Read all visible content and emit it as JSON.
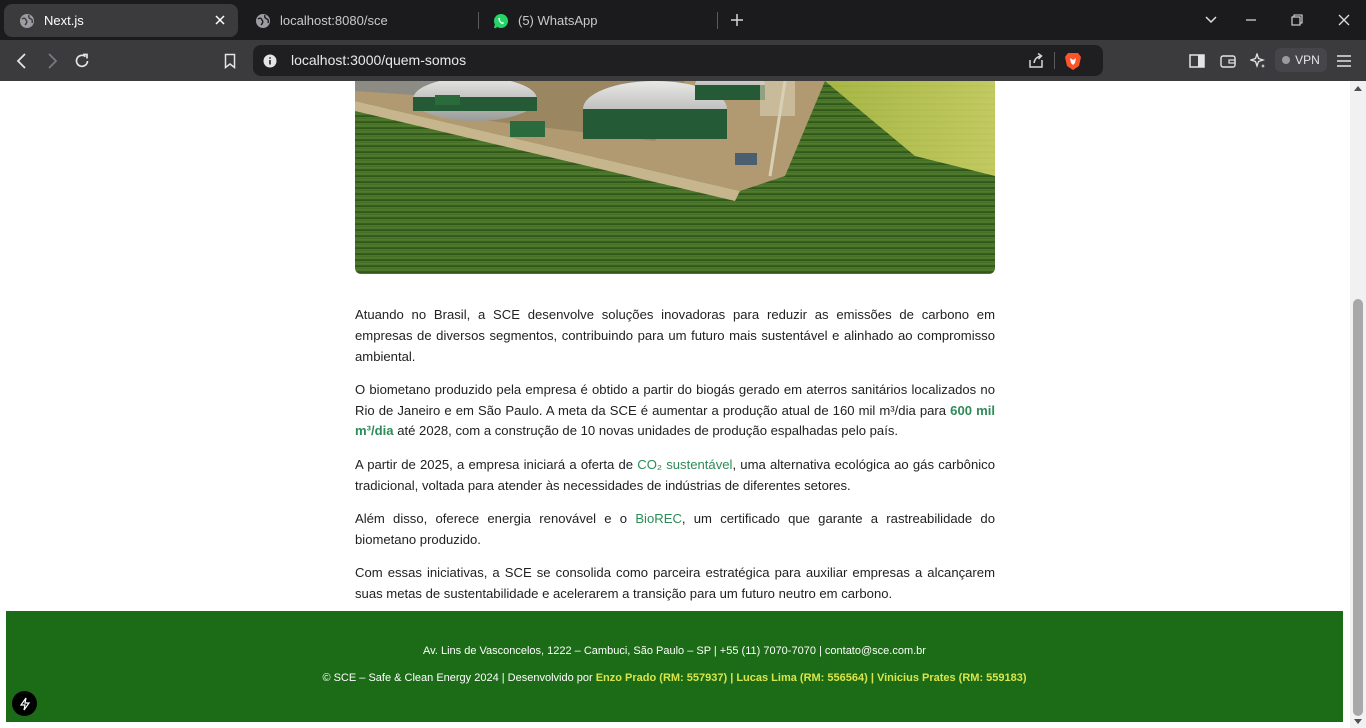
{
  "tabs": [
    {
      "title": "Next.js",
      "active": true,
      "icon": "globe-icon"
    },
    {
      "title": "localhost:8080/sce",
      "active": false,
      "icon": "globe-icon"
    },
    {
      "title": "(5) WhatsApp",
      "active": false,
      "icon": "whatsapp-icon"
    }
  ],
  "address_bar": {
    "url": "localhost:3000/quem-somos"
  },
  "vpn_label": "VPN",
  "content": {
    "p1": "Atuando no Brasil, a SCE desenvolve soluções inovadoras para reduzir as emissões de carbono em empresas de diversos segmentos, contribuindo para um futuro mais sustentável e alinhado ao compromisso ambiental.",
    "p2_before": "O biometano produzido pela empresa é obtido a partir do biogás gerado em aterros sanitários localizados no Rio de Janeiro e em São Paulo. A meta da SCE é aumentar a produção atual de 160 mil m³/dia para ",
    "p2_highlight": "600 mil m³/dia",
    "p2_after": " até 2028, com a construção de 10 novas unidades de produção espalhadas pelo país.",
    "p3_before": "A partir de 2025, a empresa iniciará a oferta de ",
    "p3_highlight": "CO₂ sustentável",
    "p3_after": ", uma alternativa ecológica ao gás carbônico tradicional, voltada para atender às necessidades de indústrias de diferentes setores.",
    "p4_before": "Além disso, oferece energia renovável e o ",
    "p4_highlight": "BioREC",
    "p4_after": ", um certificado que garante a rastreabilidade do biometano produzido.",
    "p5": "Com essas iniciativas, a SCE se consolida como parceira estratégica para auxiliar empresas a alcançarem suas metas de sustentabilidade e acelerarem a transição para um futuro neutro em carbono."
  },
  "footer": {
    "address": "Av. Lins de Vasconcelos, 1222 – Cambuci, São Paulo – SP | +55 (11) 7070-7070 | contato@sce.com.br",
    "copyright": "© SCE – Safe & Clean Energy 2024 | Desenvolvido por ",
    "credits": "Enzo Prado (RM: 557937) | Lucas Lima (RM: 556564) | Vinicius Prates (RM: 559183)"
  },
  "colors": {
    "highlight": "#2e8b57",
    "footer_bg": "#1c6b16",
    "footer_credit": "#d8e64a",
    "chrome_bg": "#1b1b1d",
    "toolbar_bg": "#3b3b3e"
  }
}
